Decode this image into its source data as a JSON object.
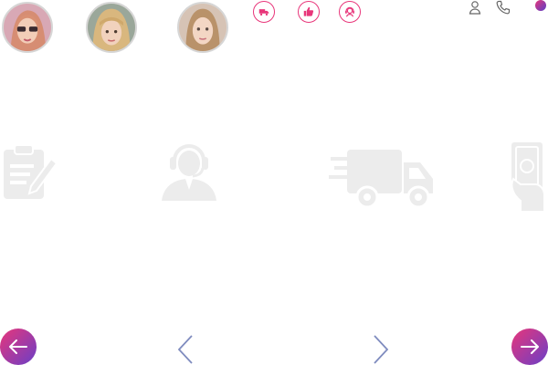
{
  "avatars": [
    {
      "name": "avatar-1"
    },
    {
      "name": "avatar-2"
    },
    {
      "name": "avatar-3"
    }
  ],
  "badges": [
    "truck-icon",
    "thumbs-up-icon",
    "support-agent-icon"
  ],
  "top_right": [
    "user-icon",
    "phone-icon",
    "status-dot"
  ],
  "features": [
    "clipboard-icon",
    "support-agent-icon",
    "delivery-truck-icon",
    "cash-hand-icon"
  ],
  "nav": {
    "prev_round": "arrow-left-icon",
    "prev_thin": "chevron-left-icon",
    "next_thin": "chevron-right-icon",
    "next_round": "arrow-right-icon"
  },
  "colors": {
    "accent_pink": "#e8367a",
    "accent_purple": "#5a3fc7",
    "muted_icon": "#ececec",
    "chevron": "#7f8cbf"
  }
}
